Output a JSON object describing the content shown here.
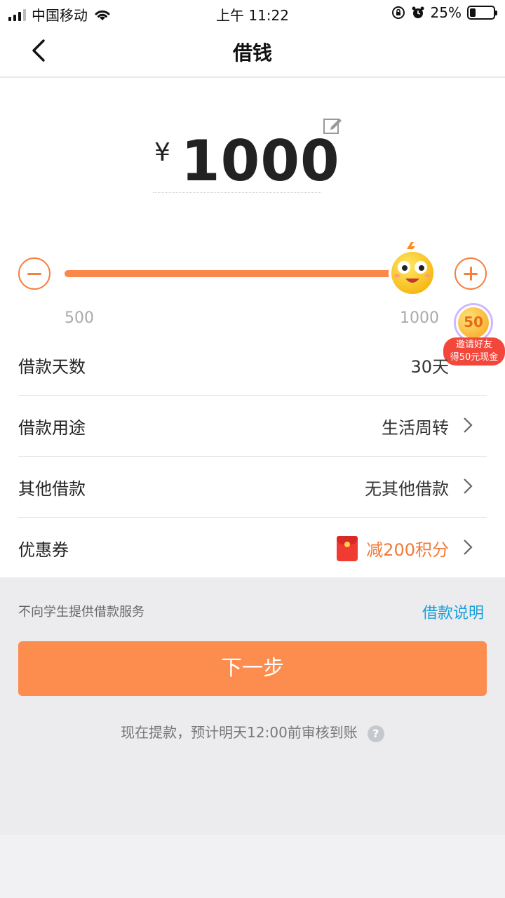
{
  "status_bar": {
    "carrier": "中国移动",
    "time": "上午 11:22",
    "battery": "25%"
  },
  "nav": {
    "title": "借钱"
  },
  "amount": {
    "currency": "¥",
    "value": "1000"
  },
  "slider": {
    "min_label": "500",
    "max_label": "1000",
    "value_fraction": 1.0
  },
  "promo": {
    "badge": "50",
    "line1": "邀请好友",
    "line2": "得50元现金"
  },
  "rows": [
    {
      "label": "借款天数",
      "value": "30天"
    },
    {
      "label": "借款用途",
      "value": "生活周转"
    },
    {
      "label": "其他借款",
      "value": "无其他借款"
    },
    {
      "label": "优惠券",
      "value": "减200积分"
    }
  ],
  "bottom": {
    "notice": "不向学生提供借款服务",
    "explain_link": "借款说明",
    "next_button": "下一步",
    "arrival_text": "现在提款，预计明天12:00前审核到账",
    "help_glyph": "?"
  },
  "colors": {
    "accent": "#f9884a",
    "button": "#fd8c4f",
    "link": "#1a9ed8",
    "coupon_text": "#f07b3a"
  },
  "icons": [
    "wifi-icon",
    "lock-rotation-icon",
    "alarm-icon",
    "back-icon",
    "edit-icon",
    "chevron-right-icon",
    "red-packet-icon",
    "help-icon"
  ]
}
